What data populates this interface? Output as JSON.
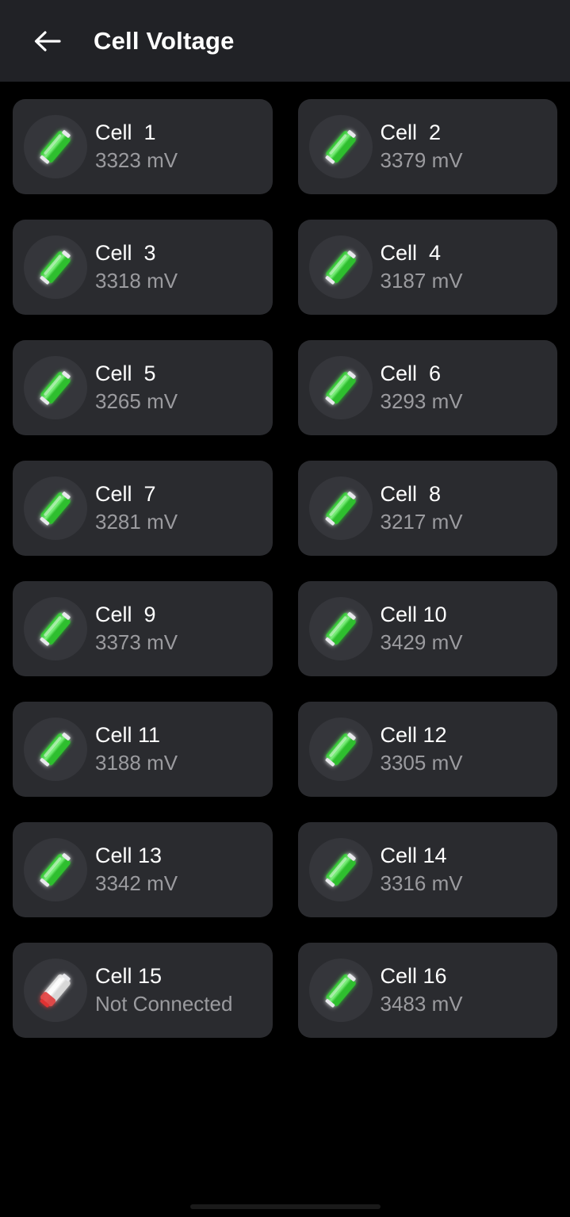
{
  "appbar": {
    "title": "Cell Voltage",
    "back_icon": "arrow-left-icon"
  },
  "colors": {
    "page_background": "#000000",
    "appbar_background": "#212226",
    "card_background": "#2a2b2f",
    "icon_circle_background": "#35363b",
    "title_text": "#ffffff",
    "value_text": "#9b9b9f",
    "battery_ok": "#2fbf2f",
    "battery_fault": "#e03030"
  },
  "cells": [
    {
      "name": "Cell  1",
      "value": "3323 mV",
      "status": "ok",
      "icon": "battery-green-icon"
    },
    {
      "name": "Cell  2",
      "value": "3379 mV",
      "status": "ok",
      "icon": "battery-green-icon"
    },
    {
      "name": "Cell  3",
      "value": "3318 mV",
      "status": "ok",
      "icon": "battery-green-icon"
    },
    {
      "name": "Cell  4",
      "value": "3187 mV",
      "status": "ok",
      "icon": "battery-green-icon"
    },
    {
      "name": "Cell  5",
      "value": "3265 mV",
      "status": "ok",
      "icon": "battery-green-icon"
    },
    {
      "name": "Cell  6",
      "value": "3293 mV",
      "status": "ok",
      "icon": "battery-green-icon"
    },
    {
      "name": "Cell  7",
      "value": "3281 mV",
      "status": "ok",
      "icon": "battery-green-icon"
    },
    {
      "name": "Cell  8",
      "value": "3217 mV",
      "status": "ok",
      "icon": "battery-green-icon"
    },
    {
      "name": "Cell  9",
      "value": "3373 mV",
      "status": "ok",
      "icon": "battery-green-icon"
    },
    {
      "name": "Cell 10",
      "value": "3429 mV",
      "status": "ok",
      "icon": "battery-green-icon"
    },
    {
      "name": "Cell 11",
      "value": "3188 mV",
      "status": "ok",
      "icon": "battery-green-icon"
    },
    {
      "name": "Cell 12",
      "value": "3305 mV",
      "status": "ok",
      "icon": "battery-green-icon"
    },
    {
      "name": "Cell 13",
      "value": "3342 mV",
      "status": "ok",
      "icon": "battery-green-icon"
    },
    {
      "name": "Cell 14",
      "value": "3316 mV",
      "status": "ok",
      "icon": "battery-green-icon"
    },
    {
      "name": "Cell 15",
      "value": "Not Connected",
      "status": "disconnected",
      "icon": "battery-red-icon"
    },
    {
      "name": "Cell 16",
      "value": "3483 mV",
      "status": "ok",
      "icon": "battery-green-icon"
    }
  ]
}
